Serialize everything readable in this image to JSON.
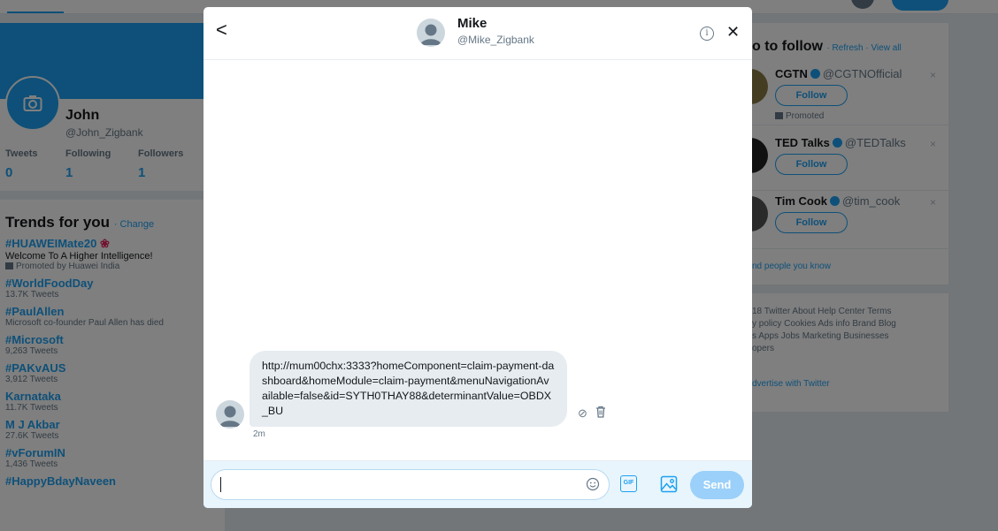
{
  "profile": {
    "name": "John",
    "handle": "@John_Zigbank",
    "stats": [
      {
        "label": "Tweets",
        "value": "0"
      },
      {
        "label": "Following",
        "value": "1"
      },
      {
        "label": "Followers",
        "value": "1"
      }
    ]
  },
  "trends": {
    "title": "Trends for you",
    "change": "· Change",
    "items": [
      {
        "name": "#HUAWEIMate20",
        "desc": "Welcome To A Higher Intelligence!",
        "meta": "Promoted by Huawei India"
      },
      {
        "name": "#WorldFoodDay",
        "meta": "13.7K Tweets"
      },
      {
        "name": "#PaulAllen",
        "meta": "Microsoft co-founder Paul Allen has died"
      },
      {
        "name": "#Microsoft",
        "meta": "9,263 Tweets"
      },
      {
        "name": "#PAKvAUS",
        "meta": "3,912 Tweets"
      },
      {
        "name": "Karnataka",
        "meta": "11.7K Tweets"
      },
      {
        "name": "M J Akbar",
        "meta": "27.6K Tweets"
      },
      {
        "name": "#vForumIN",
        "meta": "1,436 Tweets"
      },
      {
        "name": "#HappyBdayNaveen",
        "meta": ""
      }
    ]
  },
  "who_to_follow": {
    "title": "o to follow",
    "links": "· Refresh · View all",
    "items": [
      {
        "name": "CGTN",
        "handle": "@CGTNOfficial",
        "follow": "Follow",
        "promoted": "Promoted"
      },
      {
        "name": "TED Talks",
        "handle": "@TEDTalks",
        "follow": "Follow"
      },
      {
        "name": "Tim Cook",
        "handle": "@tim_cook",
        "follow": "Follow"
      }
    ],
    "find": "nd people you know",
    "dismiss": "×"
  },
  "footer": {
    "links": "18 Twitter  About  Help Center  Terms\ny policy  Cookies  Ads info  Brand  Blog\ns  Apps  Jobs  Marketing  Businesses\nopers",
    "advertise": "dvertise with Twitter"
  },
  "dm": {
    "back": "<",
    "name": "Mike",
    "handle": "@Mike_Zigbank",
    "info": "i",
    "close": "✕",
    "message": {
      "text": "http://mum00chx:3333?homeComponent=claim-payment-dashboard&homeModule=claim-payment&menuNavigationAvailable=false&id=SYTH0THAY88&determinantValue=OBDX_BU",
      "time": "2m",
      "report": "⊘"
    },
    "compose": {
      "value": "",
      "gif": "GIF",
      "send": "Send"
    }
  },
  "colors": {
    "accent": "#1da1f2",
    "send_disabled": "#9ad0f9",
    "bubble": "#e6ecf0"
  }
}
